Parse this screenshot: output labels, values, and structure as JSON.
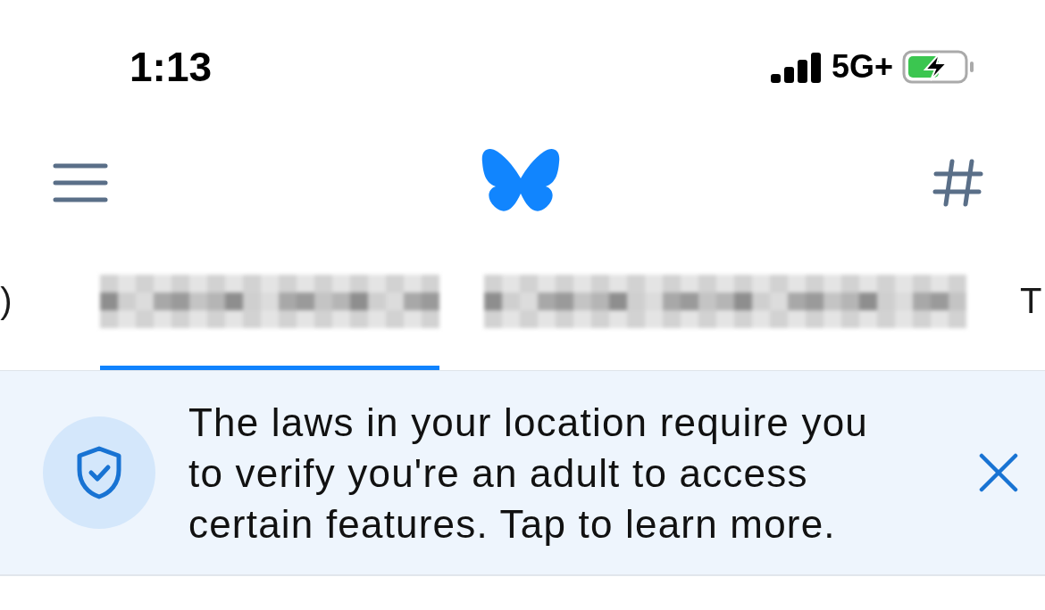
{
  "status_bar": {
    "time": "1:13",
    "network": "5G+",
    "charging": true
  },
  "tabs": [
    {
      "kind": "text",
      "label": ")",
      "selected": false
    },
    {
      "kind": "pixelated",
      "selected": true
    },
    {
      "kind": "pixelated",
      "selected": false
    },
    {
      "kind": "text",
      "label": "T",
      "selected": false
    }
  ],
  "banner": {
    "message": "The laws in your location require you to verify you're an adult to access certain features. Tap to learn more."
  }
}
